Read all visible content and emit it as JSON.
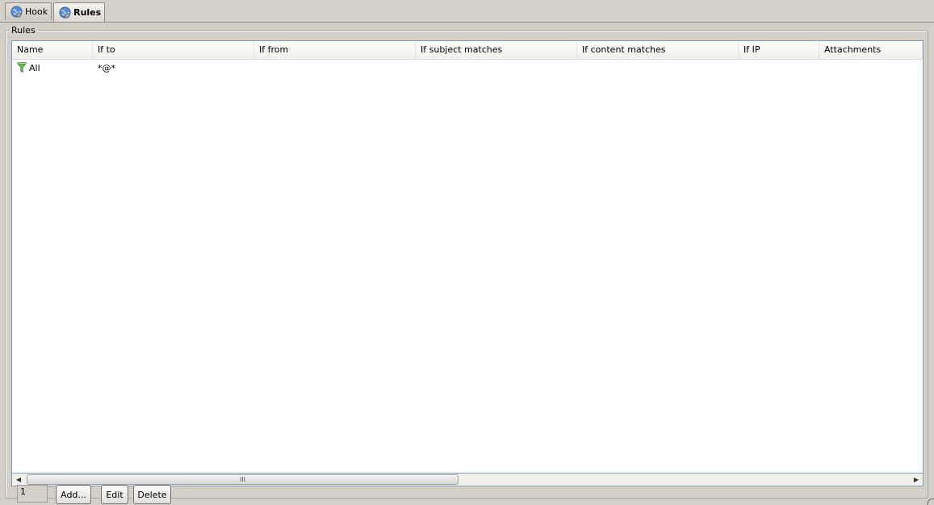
{
  "tabs": [
    {
      "label": "Hook",
      "icon": "globe-icon",
      "active": false
    },
    {
      "label": "Rules",
      "icon": "globe-icon",
      "active": true
    }
  ],
  "group": {
    "label": "Rules"
  },
  "table": {
    "columns": [
      "Name",
      "If to",
      "If from",
      "If subject matches",
      "If content matches",
      "If IP",
      "Attachments"
    ],
    "rows": [
      {
        "icon": "funnel-icon",
        "cells": [
          "All",
          "*@*",
          "",
          "",
          "",
          "",
          ""
        ]
      }
    ]
  },
  "scrollbar": {
    "grip": "III"
  },
  "footer": {
    "count": "1",
    "add_label": "Add...",
    "edit_label": "Edit",
    "delete_label": "Delete"
  },
  "colors": {
    "background": "#d4d0c8",
    "grid_border": "#7f9db9",
    "funnel": "#4caf50",
    "globe": "#2f6fb5"
  }
}
